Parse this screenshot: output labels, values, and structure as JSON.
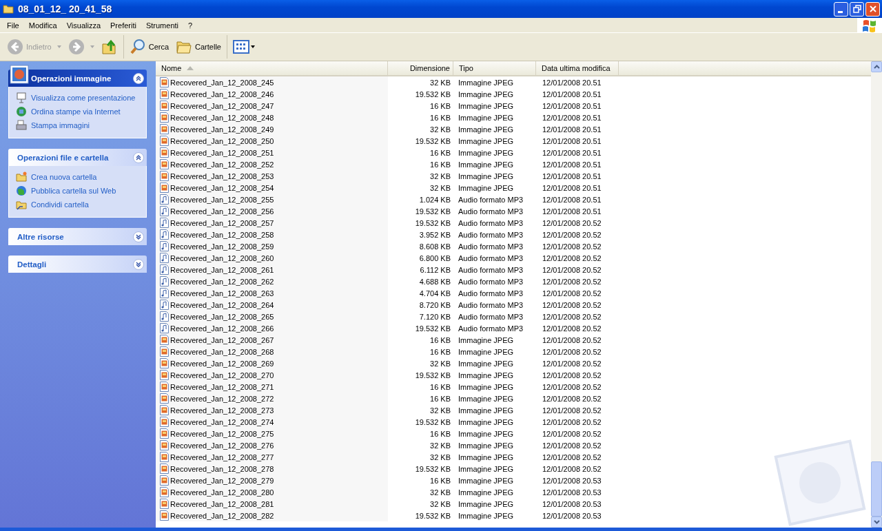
{
  "window": {
    "title": "08_01_12_ 20_41_58"
  },
  "menu": [
    "File",
    "Modifica",
    "Visualizza",
    "Preferiti",
    "Strumenti",
    "?"
  ],
  "toolbar": {
    "back": {
      "label": "Indietro",
      "disabled": true
    },
    "forward": {
      "disabled": true
    },
    "search": {
      "label": "Cerca"
    },
    "folders": {
      "label": "Cartelle"
    }
  },
  "sidebar": [
    {
      "title": "Operazioni immagine",
      "kind": "special",
      "expanded": true,
      "items": [
        {
          "label": "Visualizza come presentazione"
        },
        {
          "label": "Ordina stampe via Internet"
        },
        {
          "label": "Stampa immagini"
        }
      ]
    },
    {
      "title": "Operazioni file e cartella",
      "kind": "normal",
      "expanded": true,
      "items": [
        {
          "label": "Crea nuova cartella"
        },
        {
          "label": "Pubblica cartella sul Web"
        },
        {
          "label": "Condividi cartella"
        }
      ]
    },
    {
      "title": "Altre risorse",
      "kind": "normal",
      "expanded": false
    },
    {
      "title": "Dettagli",
      "kind": "normal",
      "expanded": false
    }
  ],
  "table": {
    "columns": [
      {
        "label": "Nome",
        "sorted": true
      },
      {
        "label": "Dimensione",
        "sorted": false
      },
      {
        "label": "Tipo",
        "sorted": false
      },
      {
        "label": "Data ultima modifica",
        "sorted": false
      }
    ],
    "rows": [
      {
        "kind": "image",
        "name": "Recovered_Jan_12_2008_245",
        "size": "32 KB",
        "type": "Immagine JPEG",
        "date": "12/01/2008 20.51"
      },
      {
        "kind": "image",
        "name": "Recovered_Jan_12_2008_246",
        "size": "19.532 KB",
        "type": "Immagine JPEG",
        "date": "12/01/2008 20.51"
      },
      {
        "kind": "image",
        "name": "Recovered_Jan_12_2008_247",
        "size": "16 KB",
        "type": "Immagine JPEG",
        "date": "12/01/2008 20.51"
      },
      {
        "kind": "image",
        "name": "Recovered_Jan_12_2008_248",
        "size": "16 KB",
        "type": "Immagine JPEG",
        "date": "12/01/2008 20.51"
      },
      {
        "kind": "image",
        "name": "Recovered_Jan_12_2008_249",
        "size": "32 KB",
        "type": "Immagine JPEG",
        "date": "12/01/2008 20.51"
      },
      {
        "kind": "image",
        "name": "Recovered_Jan_12_2008_250",
        "size": "19.532 KB",
        "type": "Immagine JPEG",
        "date": "12/01/2008 20.51"
      },
      {
        "kind": "image",
        "name": "Recovered_Jan_12_2008_251",
        "size": "16 KB",
        "type": "Immagine JPEG",
        "date": "12/01/2008 20.51"
      },
      {
        "kind": "image",
        "name": "Recovered_Jan_12_2008_252",
        "size": "16 KB",
        "type": "Immagine JPEG",
        "date": "12/01/2008 20.51"
      },
      {
        "kind": "image",
        "name": "Recovered_Jan_12_2008_253",
        "size": "32 KB",
        "type": "Immagine JPEG",
        "date": "12/01/2008 20.51"
      },
      {
        "kind": "image",
        "name": "Recovered_Jan_12_2008_254",
        "size": "32 KB",
        "type": "Immagine JPEG",
        "date": "12/01/2008 20.51"
      },
      {
        "kind": "audio",
        "name": "Recovered_Jan_12_2008_255",
        "size": "1.024 KB",
        "type": "Audio formato MP3",
        "date": "12/01/2008 20.51"
      },
      {
        "kind": "audio",
        "name": "Recovered_Jan_12_2008_256",
        "size": "19.532 KB",
        "type": "Audio formato MP3",
        "date": "12/01/2008 20.51"
      },
      {
        "kind": "audio",
        "name": "Recovered_Jan_12_2008_257",
        "size": "19.532 KB",
        "type": "Audio formato MP3",
        "date": "12/01/2008 20.52"
      },
      {
        "kind": "audio",
        "name": "Recovered_Jan_12_2008_258",
        "size": "3.952 KB",
        "type": "Audio formato MP3",
        "date": "12/01/2008 20.52"
      },
      {
        "kind": "audio",
        "name": "Recovered_Jan_12_2008_259",
        "size": "8.608 KB",
        "type": "Audio formato MP3",
        "date": "12/01/2008 20.52"
      },
      {
        "kind": "audio",
        "name": "Recovered_Jan_12_2008_260",
        "size": "6.800 KB",
        "type": "Audio formato MP3",
        "date": "12/01/2008 20.52"
      },
      {
        "kind": "audio",
        "name": "Recovered_Jan_12_2008_261",
        "size": "6.112 KB",
        "type": "Audio formato MP3",
        "date": "12/01/2008 20.52"
      },
      {
        "kind": "audio",
        "name": "Recovered_Jan_12_2008_262",
        "size": "4.688 KB",
        "type": "Audio formato MP3",
        "date": "12/01/2008 20.52"
      },
      {
        "kind": "audio",
        "name": "Recovered_Jan_12_2008_263",
        "size": "4.704 KB",
        "type": "Audio formato MP3",
        "date": "12/01/2008 20.52"
      },
      {
        "kind": "audio",
        "name": "Recovered_Jan_12_2008_264",
        "size": "8.720 KB",
        "type": "Audio formato MP3",
        "date": "12/01/2008 20.52"
      },
      {
        "kind": "audio",
        "name": "Recovered_Jan_12_2008_265",
        "size": "7.120 KB",
        "type": "Audio formato MP3",
        "date": "12/01/2008 20.52"
      },
      {
        "kind": "audio",
        "name": "Recovered_Jan_12_2008_266",
        "size": "19.532 KB",
        "type": "Audio formato MP3",
        "date": "12/01/2008 20.52"
      },
      {
        "kind": "image",
        "name": "Recovered_Jan_12_2008_267",
        "size": "16 KB",
        "type": "Immagine JPEG",
        "date": "12/01/2008 20.52"
      },
      {
        "kind": "image",
        "name": "Recovered_Jan_12_2008_268",
        "size": "16 KB",
        "type": "Immagine JPEG",
        "date": "12/01/2008 20.52"
      },
      {
        "kind": "image",
        "name": "Recovered_Jan_12_2008_269",
        "size": "32 KB",
        "type": "Immagine JPEG",
        "date": "12/01/2008 20.52"
      },
      {
        "kind": "image",
        "name": "Recovered_Jan_12_2008_270",
        "size": "19.532 KB",
        "type": "Immagine JPEG",
        "date": "12/01/2008 20.52"
      },
      {
        "kind": "image",
        "name": "Recovered_Jan_12_2008_271",
        "size": "16 KB",
        "type": "Immagine JPEG",
        "date": "12/01/2008 20.52"
      },
      {
        "kind": "image",
        "name": "Recovered_Jan_12_2008_272",
        "size": "16 KB",
        "type": "Immagine JPEG",
        "date": "12/01/2008 20.52"
      },
      {
        "kind": "image",
        "name": "Recovered_Jan_12_2008_273",
        "size": "32 KB",
        "type": "Immagine JPEG",
        "date": "12/01/2008 20.52"
      },
      {
        "kind": "image",
        "name": "Recovered_Jan_12_2008_274",
        "size": "19.532 KB",
        "type": "Immagine JPEG",
        "date": "12/01/2008 20.52"
      },
      {
        "kind": "image",
        "name": "Recovered_Jan_12_2008_275",
        "size": "16 KB",
        "type": "Immagine JPEG",
        "date": "12/01/2008 20.52"
      },
      {
        "kind": "image",
        "name": "Recovered_Jan_12_2008_276",
        "size": "32 KB",
        "type": "Immagine JPEG",
        "date": "12/01/2008 20.52"
      },
      {
        "kind": "image",
        "name": "Recovered_Jan_12_2008_277",
        "size": "32 KB",
        "type": "Immagine JPEG",
        "date": "12/01/2008 20.52"
      },
      {
        "kind": "image",
        "name": "Recovered_Jan_12_2008_278",
        "size": "19.532 KB",
        "type": "Immagine JPEG",
        "date": "12/01/2008 20.52"
      },
      {
        "kind": "image",
        "name": "Recovered_Jan_12_2008_279",
        "size": "16 KB",
        "type": "Immagine JPEG",
        "date": "12/01/2008 20.53"
      },
      {
        "kind": "image",
        "name": "Recovered_Jan_12_2008_280",
        "size": "32 KB",
        "type": "Immagine JPEG",
        "date": "12/01/2008 20.53"
      },
      {
        "kind": "image",
        "name": "Recovered_Jan_12_2008_281",
        "size": "32 KB",
        "type": "Immagine JPEG",
        "date": "12/01/2008 20.53"
      },
      {
        "kind": "image",
        "name": "Recovered_Jan_12_2008_282",
        "size": "19.532 KB",
        "type": "Immagine JPEG",
        "date": "12/01/2008 20.53"
      }
    ]
  }
}
